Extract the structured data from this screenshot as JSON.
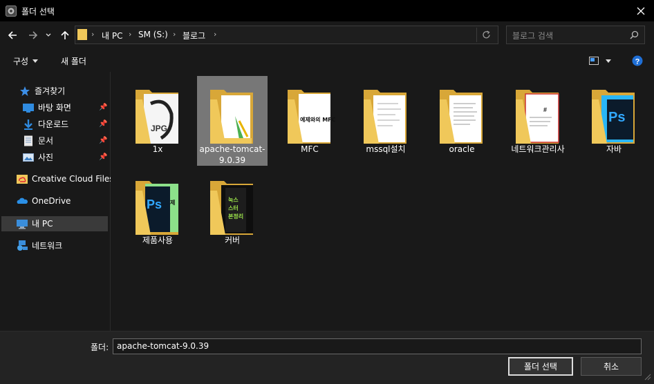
{
  "window": {
    "title": "폴더 선택"
  },
  "address": {
    "crumbs": [
      "내 PC",
      "SM (S:)",
      "블로그"
    ]
  },
  "search": {
    "placeholder": "블로그 검색"
  },
  "toolbar": {
    "organize": "구성",
    "new_folder": "새 폴더"
  },
  "sidebar": {
    "quick_access": "즐겨찾기",
    "items": [
      {
        "label": "바탕 화면",
        "icon": "desktop-icon",
        "pinned": true
      },
      {
        "label": "다운로드",
        "icon": "download-icon",
        "pinned": true
      },
      {
        "label": "문서",
        "icon": "document-icon",
        "pinned": true
      },
      {
        "label": "사진",
        "icon": "pictures-icon",
        "pinned": true
      }
    ],
    "creative_cloud": "Creative Cloud Files",
    "onedrive": "OneDrive",
    "this_pc": "내 PC",
    "network": "네트워크"
  },
  "folders": [
    {
      "name": "1x"
    },
    {
      "name": "apache-tomcat-9.0.39",
      "selected": true
    },
    {
      "name": "MFC"
    },
    {
      "name": "mssql설치"
    },
    {
      "name": "oracle"
    },
    {
      "name": "네트워크관리사"
    },
    {
      "name": "자바"
    },
    {
      "name": "제품사용"
    },
    {
      "name": "커버"
    }
  ],
  "footer": {
    "folder_label": "폴더:",
    "folder_value": "apache-tomcat-9.0.39",
    "select_button": "폴더 선택",
    "cancel_button": "취소"
  },
  "colors": {
    "accent": "#4a9eff",
    "folder": "#f0c85a",
    "selection": "#777777"
  }
}
